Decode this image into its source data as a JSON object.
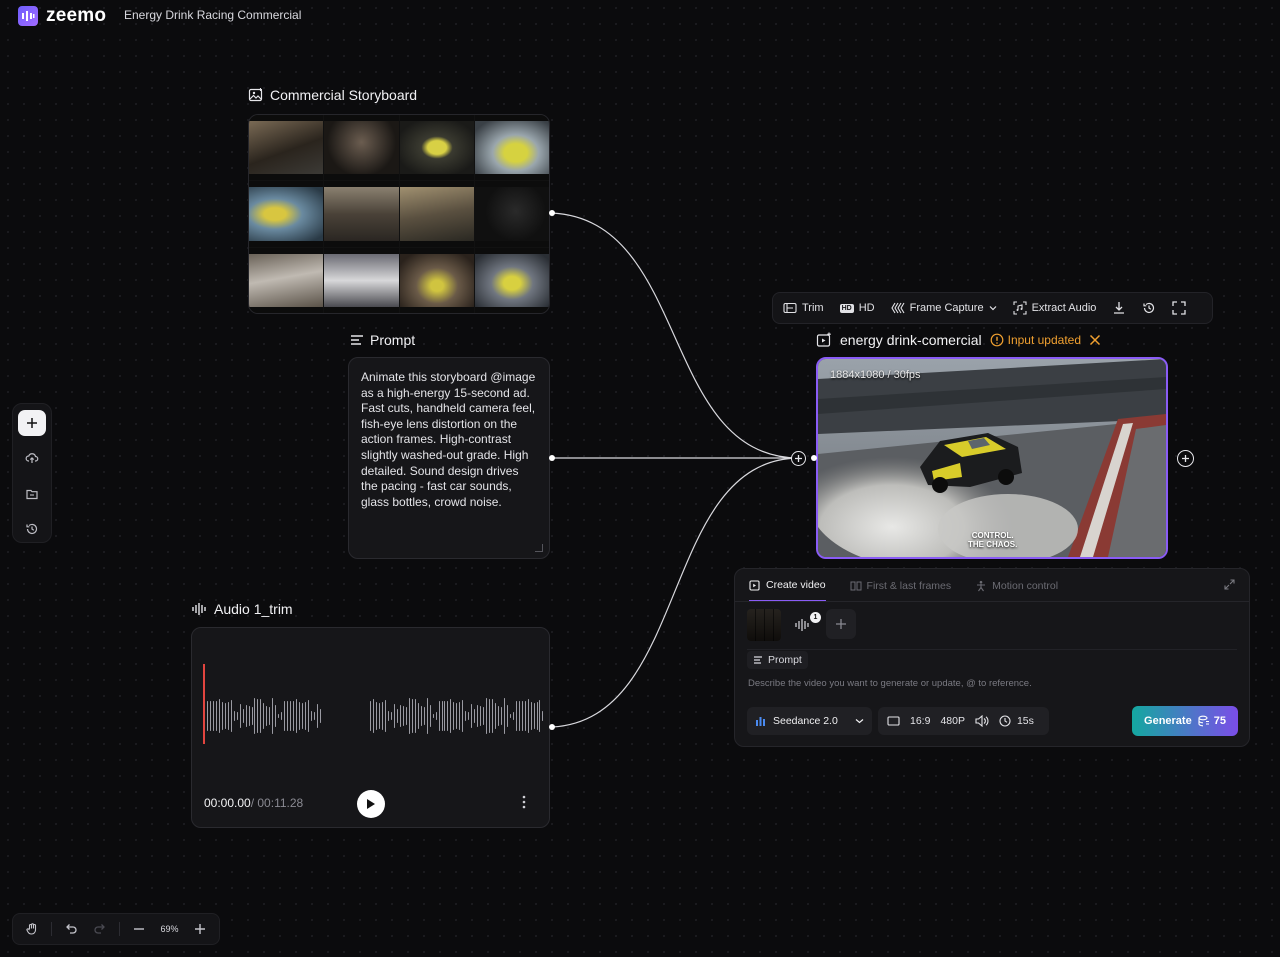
{
  "app": {
    "logo_text": "zeemo",
    "project_title": "Energy Drink Racing Commercial"
  },
  "storyboard": {
    "title": "Commercial Storyboard"
  },
  "prompt_node": {
    "title": "Prompt",
    "text": "Animate this storyboard @image as a high-energy 15-second ad. Fast cuts, handheld camera feel, fish-eye lens distortion on the action frames. High-contrast slightly washed-out grade. High detailed. Sound design drives the pacing - fast car sounds, glass bottles, crowd noise."
  },
  "audio_node": {
    "title": "Audio 1_trim",
    "current_time": "00:00.00",
    "duration": "/ 00:11.28"
  },
  "video_toolbar": {
    "trim": "Trim",
    "hd": "HD",
    "frame_capture": "Frame Capture",
    "extract_audio": "Extract Audio"
  },
  "video_node": {
    "title": "energy drink-comercial",
    "status": "Input updated",
    "meta": "1884x1080 / 30fps",
    "caption_line1": "CONTROL.",
    "caption_line2": "THE CHAOS."
  },
  "gen_panel": {
    "tabs": [
      "Create video",
      "First & last frames",
      "Motion control"
    ],
    "ref_count": "1",
    "prompt_chip": "Prompt",
    "placeholder": "Describe the video you want to generate or update, @ to reference.",
    "model": "Seedance 2.0",
    "aspect": "16:9",
    "resolution": "480P",
    "duration": "15s",
    "generate": "Generate",
    "credits": "75"
  },
  "zoom": {
    "level": "69%"
  },
  "colors": {
    "accent": "#8a5cf6",
    "warning": "#f0a030",
    "playhead": "#e2453f"
  }
}
